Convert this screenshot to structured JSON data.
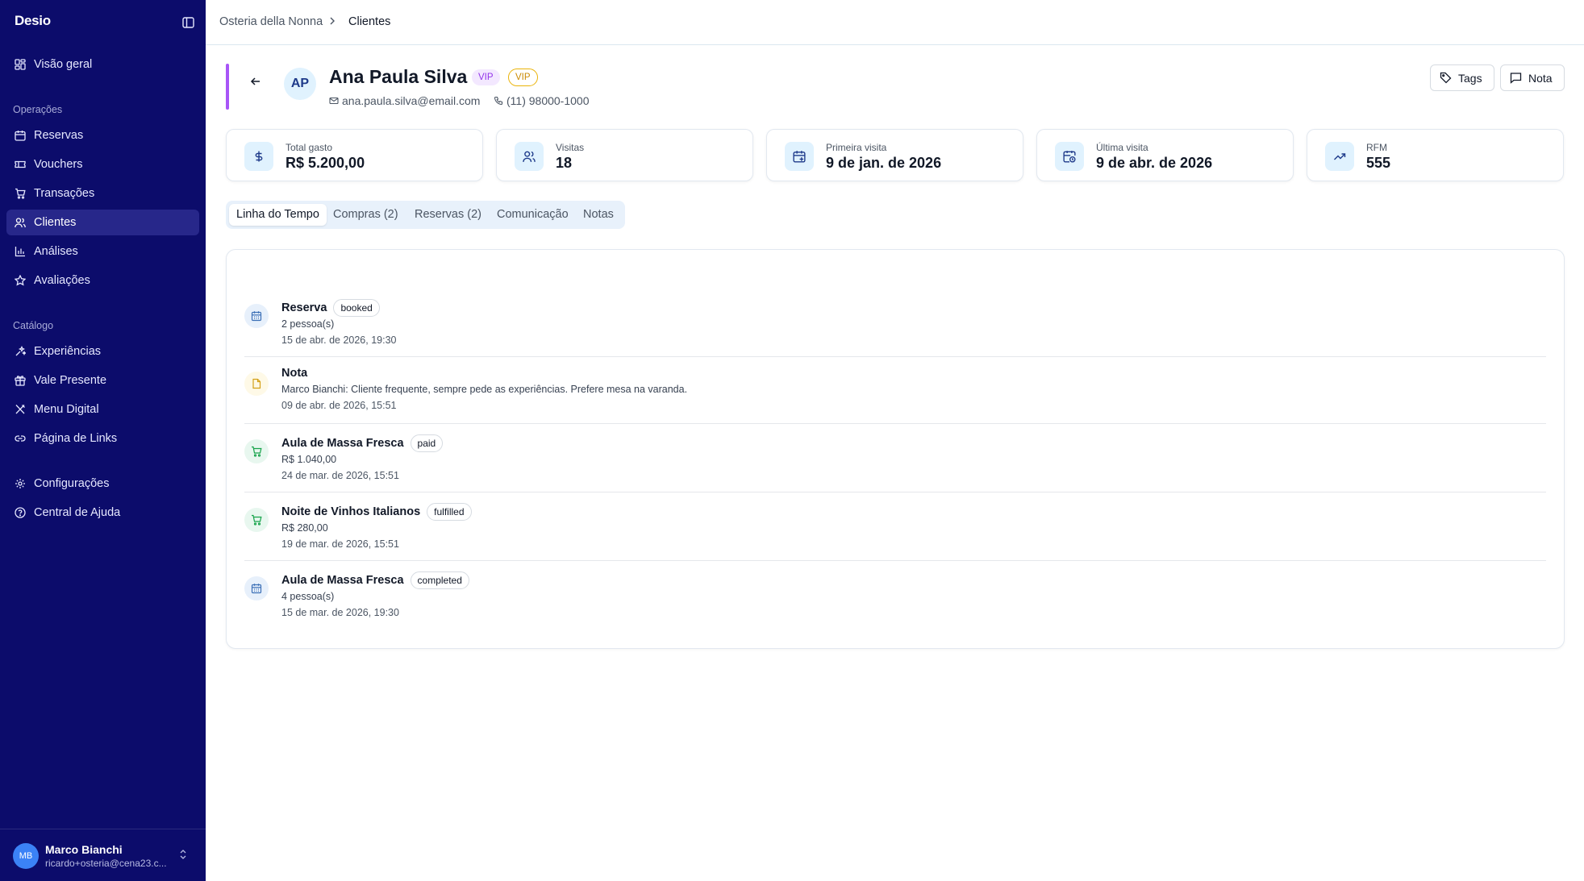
{
  "sidebar": {
    "brand": "Desio",
    "top_items": [
      {
        "label": "Visão geral",
        "icon": "dashboard-icon"
      }
    ],
    "sections": [
      {
        "label": "Operações",
        "items": [
          {
            "label": "Reservas",
            "icon": "calendar-icon"
          },
          {
            "label": "Vouchers",
            "icon": "ticket-icon"
          },
          {
            "label": "Transações",
            "icon": "cart-icon"
          },
          {
            "label": "Clientes",
            "icon": "users-icon",
            "active": true
          },
          {
            "label": "Análises",
            "icon": "bar-chart-icon"
          },
          {
            "label": "Avaliações",
            "icon": "star-icon"
          }
        ]
      },
      {
        "label": "Catálogo",
        "items": [
          {
            "label": "Experiências",
            "icon": "sparkles-icon"
          },
          {
            "label": "Vale Presente",
            "icon": "gift-icon"
          },
          {
            "label": "Menu Digital",
            "icon": "utensils-icon"
          },
          {
            "label": "Página de Links",
            "icon": "link-icon"
          }
        ]
      }
    ],
    "bottom_items": [
      {
        "label": "Configurações",
        "icon": "gear-icon"
      },
      {
        "label": "Central de Ajuda",
        "icon": "help-circle-icon"
      }
    ],
    "user": {
      "initials": "MB",
      "name": "Marco Bianchi",
      "email": "ricardo+osteria@cena23.c..."
    }
  },
  "breadcrumb": [
    "Osteria della Nonna",
    "Clientes"
  ],
  "customer": {
    "initials": "AP",
    "name": "Ana Paula Silva",
    "badges": [
      "VIP",
      "VIP"
    ],
    "email": "ana.paula.silva@email.com",
    "phone": "(11) 98000-1000"
  },
  "actions": {
    "tags": "Tags",
    "nota": "Nota"
  },
  "stats": [
    {
      "label": "Total gasto",
      "value": "R$ 5.200,00",
      "icon": "dollar-icon"
    },
    {
      "label": "Visitas",
      "value": "18",
      "icon": "users-icon"
    },
    {
      "label": "Primeira visita",
      "value": "9 de jan. de 2026",
      "icon": "calendar-plus-icon"
    },
    {
      "label": "Última visita",
      "value": "9 de abr. de 2026",
      "icon": "calendar-clock-icon"
    },
    {
      "label": "RFM",
      "value": "555",
      "icon": "trending-up-icon"
    }
  ],
  "tabs": [
    "Linha do Tempo",
    "Compras (2)",
    "Reservas (2)",
    "Comunicação",
    "Notas"
  ],
  "active_tab": "Linha do Tempo",
  "timeline": [
    {
      "type": "reservation",
      "title": "Reserva",
      "badge": "booked",
      "detail": "2 pessoa(s)",
      "date": "15 de abr. de 2026, 19:30"
    },
    {
      "type": "note",
      "title": "Nota",
      "badge": "",
      "detail": "Marco Bianchi: Cliente frequente, sempre pede as experiências. Prefere mesa na varanda.",
      "date": "09 de abr. de 2026, 15:51"
    },
    {
      "type": "purchase",
      "title": "Aula de Massa Fresca",
      "badge": "paid",
      "detail": "R$ 1.040,00",
      "date": "24 de mar. de 2026, 15:51"
    },
    {
      "type": "purchase",
      "title": "Noite de Vinhos Italianos",
      "badge": "fulfilled",
      "detail": "R$ 280,00",
      "date": "19 de mar. de 2026, 15:51"
    },
    {
      "type": "reservation",
      "title": "Aula de Massa Fresca",
      "badge": "completed",
      "detail": "4 pessoa(s)",
      "date": "15 de mar. de 2026, 19:30"
    }
  ],
  "colors": {
    "sidebar_bg": "#0c0c6b",
    "sidebar_active": "#27278a",
    "accent": "#a855f7",
    "vip": "#9333ea",
    "vip_outline": "#ca8a04"
  }
}
